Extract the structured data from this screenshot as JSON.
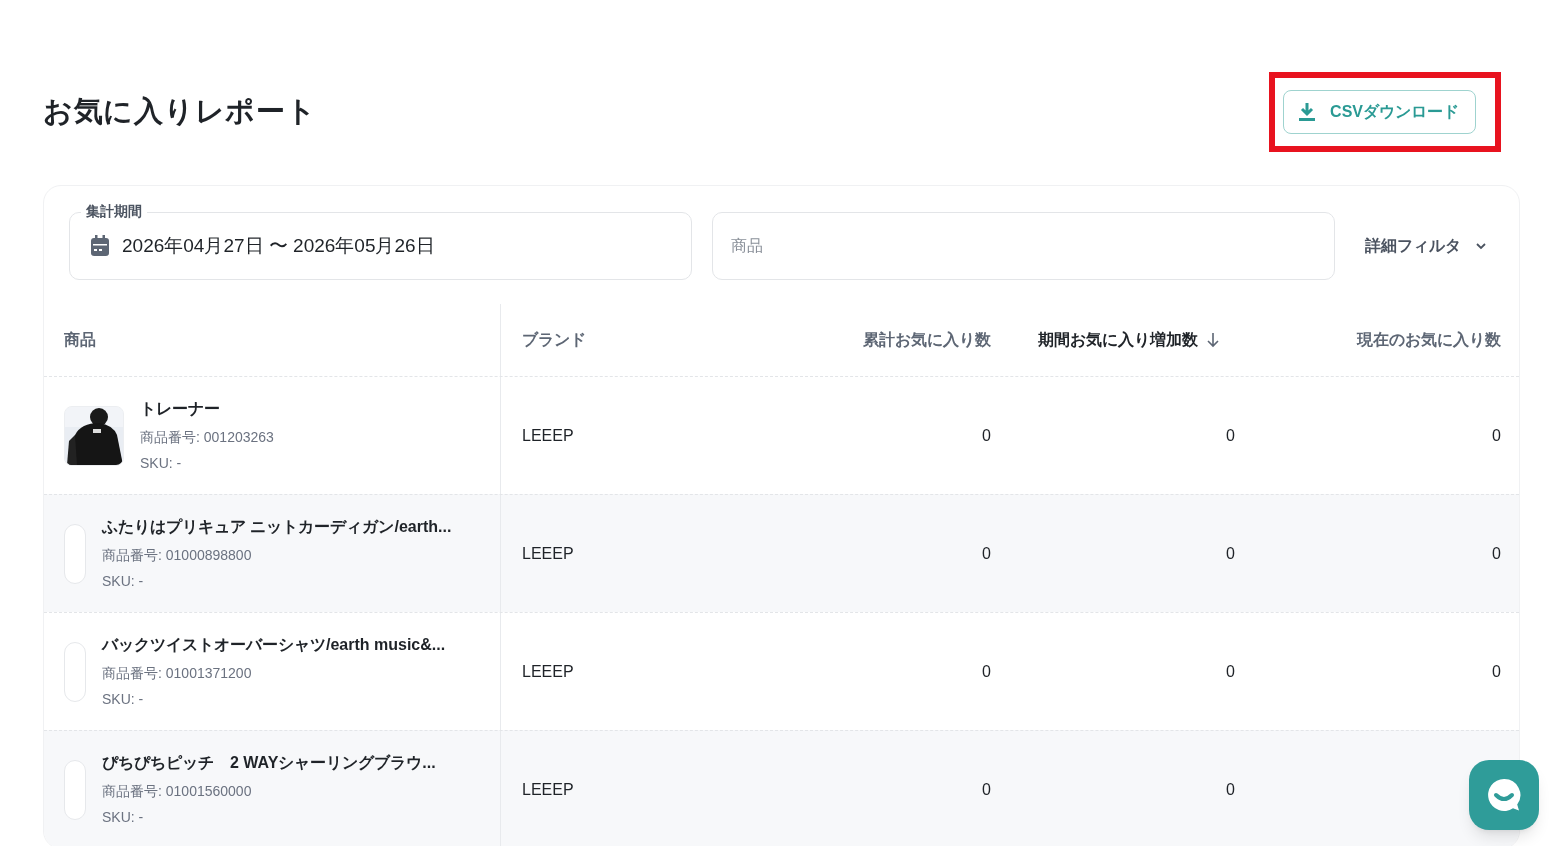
{
  "page": {
    "title": "お気に入りレポート"
  },
  "csv_button": {
    "label": "CSVダウンロード",
    "highlighted": true
  },
  "filters": {
    "period": {
      "label": "集計期間",
      "value": "2026年04月27日 〜 2026年05月26日"
    },
    "product": {
      "placeholder": "商品"
    },
    "detail_filter": {
      "label": "詳細フィルタ",
      "expanded": false
    }
  },
  "table": {
    "columns": [
      {
        "label": "商品",
        "sorted": false
      },
      {
        "label": "ブランド",
        "sorted": false
      },
      {
        "label": "累計お気に入り数",
        "sorted": false
      },
      {
        "label": "期間お気に入り増加数",
        "sorted": true
      },
      {
        "label": "現在のお気に入り数",
        "sorted": false
      }
    ],
    "rows": [
      {
        "kind": "picture",
        "name": "トレーナー",
        "number": "商品番号: 001203263",
        "sku": "SKU: -",
        "brand": "LEEEP",
        "total": "0",
        "increase": "0",
        "current": "0"
      },
      {
        "kind": "blank",
        "name": "ふたりはプリキュア ニットカーディガン/earth...",
        "number": "商品番号: 01000898800",
        "sku": "SKU: -",
        "brand": "LEEEP",
        "total": "0",
        "increase": "0",
        "current": "0"
      },
      {
        "kind": "blank",
        "name": "バックツイストオーバーシャツ/earth music&...",
        "number": "商品番号: 01001371200",
        "sku": "SKU: -",
        "brand": "LEEEP",
        "total": "0",
        "increase": "0",
        "current": "0"
      },
      {
        "kind": "blank",
        "name": "ぴちぴちピッチ　2 WAYシャーリングブラウ...",
        "number": "商品番号: 01001560000",
        "sku": "SKU: -",
        "brand": "LEEEP",
        "total": "0",
        "increase": "0"
      }
    ]
  }
}
